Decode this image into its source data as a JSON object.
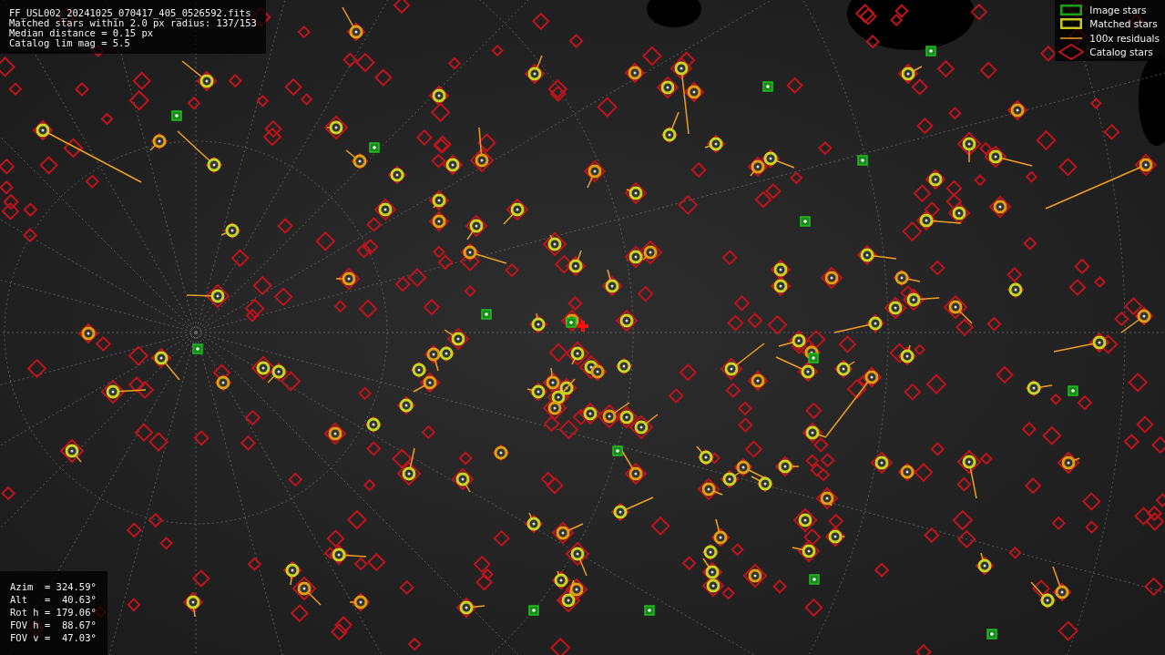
{
  "file_info": {
    "lines": [
      "FF_USL002_20241025_070417_405_0526592.fits",
      "Matched stars within 2.0 px radius: 137/153",
      "Median distance = 0.15 px",
      "Catalog lim mag = 5.5"
    ]
  },
  "legend": [
    {
      "kind": "image",
      "label": "Image stars"
    },
    {
      "kind": "matched",
      "label": "Matched stars"
    },
    {
      "kind": "residual",
      "label": "100x residuals"
    },
    {
      "kind": "catalog",
      "label": "Catalog stars"
    }
  ],
  "pointing": {
    "lines": [
      "Azim  = 324.59°",
      "Alt   =  40.63°",
      "Rot h = 179.06°",
      "FOV h =  88.67°",
      "FOV v =  47.03°"
    ]
  }
}
